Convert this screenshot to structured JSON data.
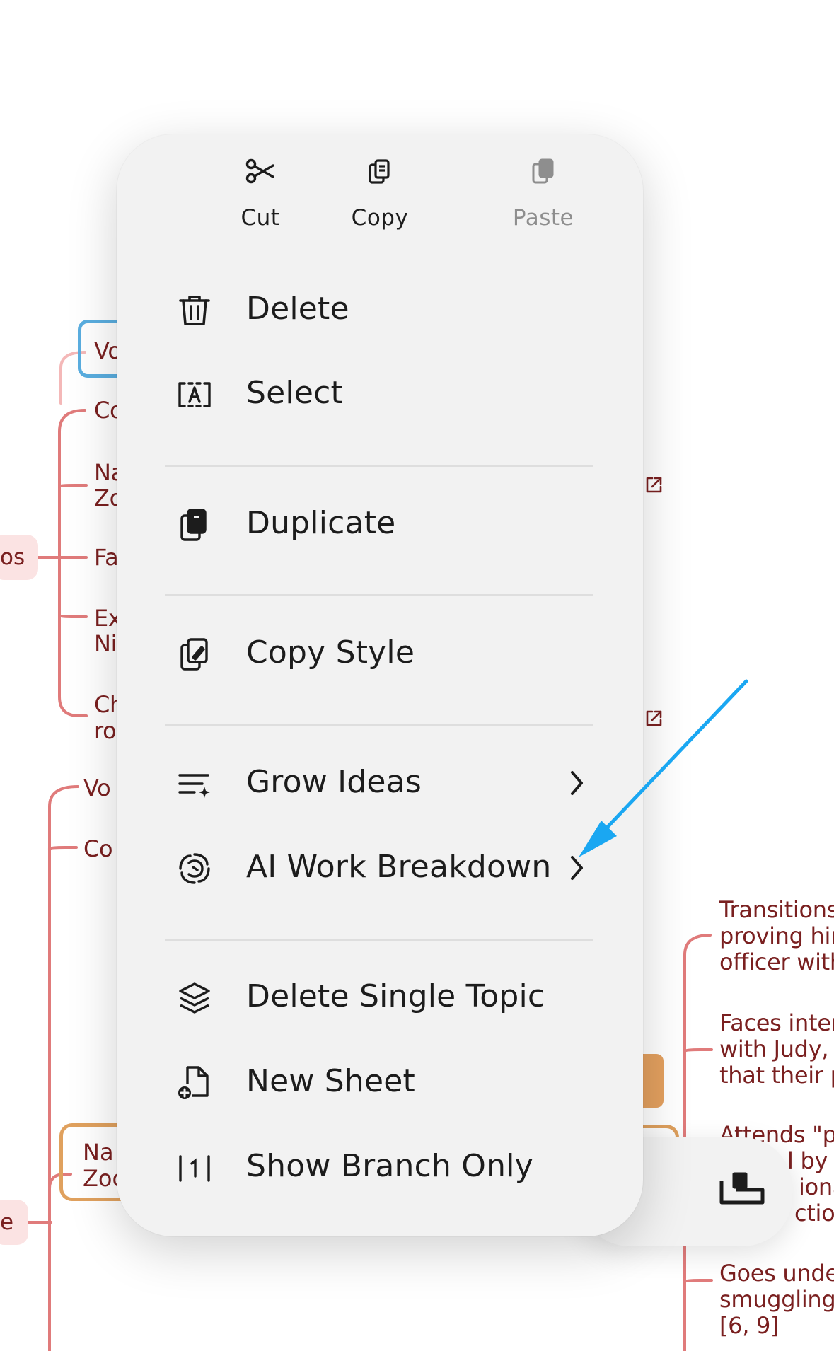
{
  "quick_actions": [
    {
      "label": "Cut",
      "icon": "scissors-icon",
      "enabled": true
    },
    {
      "label": "Copy",
      "icon": "copy-icon",
      "enabled": true
    },
    {
      "label": "Paste",
      "icon": "paste-icon",
      "enabled": false
    }
  ],
  "menu": {
    "delete": "Delete",
    "select": "Select",
    "duplicate": "Duplicate",
    "copy_style": "Copy Style",
    "grow_ideas": "Grow Ideas",
    "ai_work_breakdown": "AI Work Breakdown",
    "delete_single_topic": "Delete Single Topic",
    "new_sheet": "New Sheet",
    "show_branch_only": "Show Branch Only"
  },
  "mindmap": {
    "left_topics": [
      "Vo",
      "Co",
      "Na",
      "Zo",
      "Fa",
      "Ex",
      "Ni",
      "Ch",
      "ro",
      "Vo",
      "Co",
      "Na",
      "Zoo"
    ],
    "left_pills": [
      "os",
      "e"
    ],
    "right_topics": [
      [
        "Transitions",
        "proving hin",
        "officer with"
      ],
      [
        "Faces inter",
        "with Judy, l",
        "that their p"
      ],
      [
        "Attends \"p",
        "l by l",
        "iona",
        "ction"
      ],
      [
        "Goes unde",
        "smuggling",
        "[6, 9]"
      ]
    ]
  },
  "colors": {
    "menu_bg": "#f2f2f2",
    "text": "#1c1c1c",
    "disabled_text": "#8e8e8e",
    "branch_line": "#e07b7b",
    "topic_text": "#7a2020",
    "selection_blue": "#5aaee0",
    "accent_orange": "#e0a15e",
    "annotation_arrow": "#1aa7f2"
  }
}
